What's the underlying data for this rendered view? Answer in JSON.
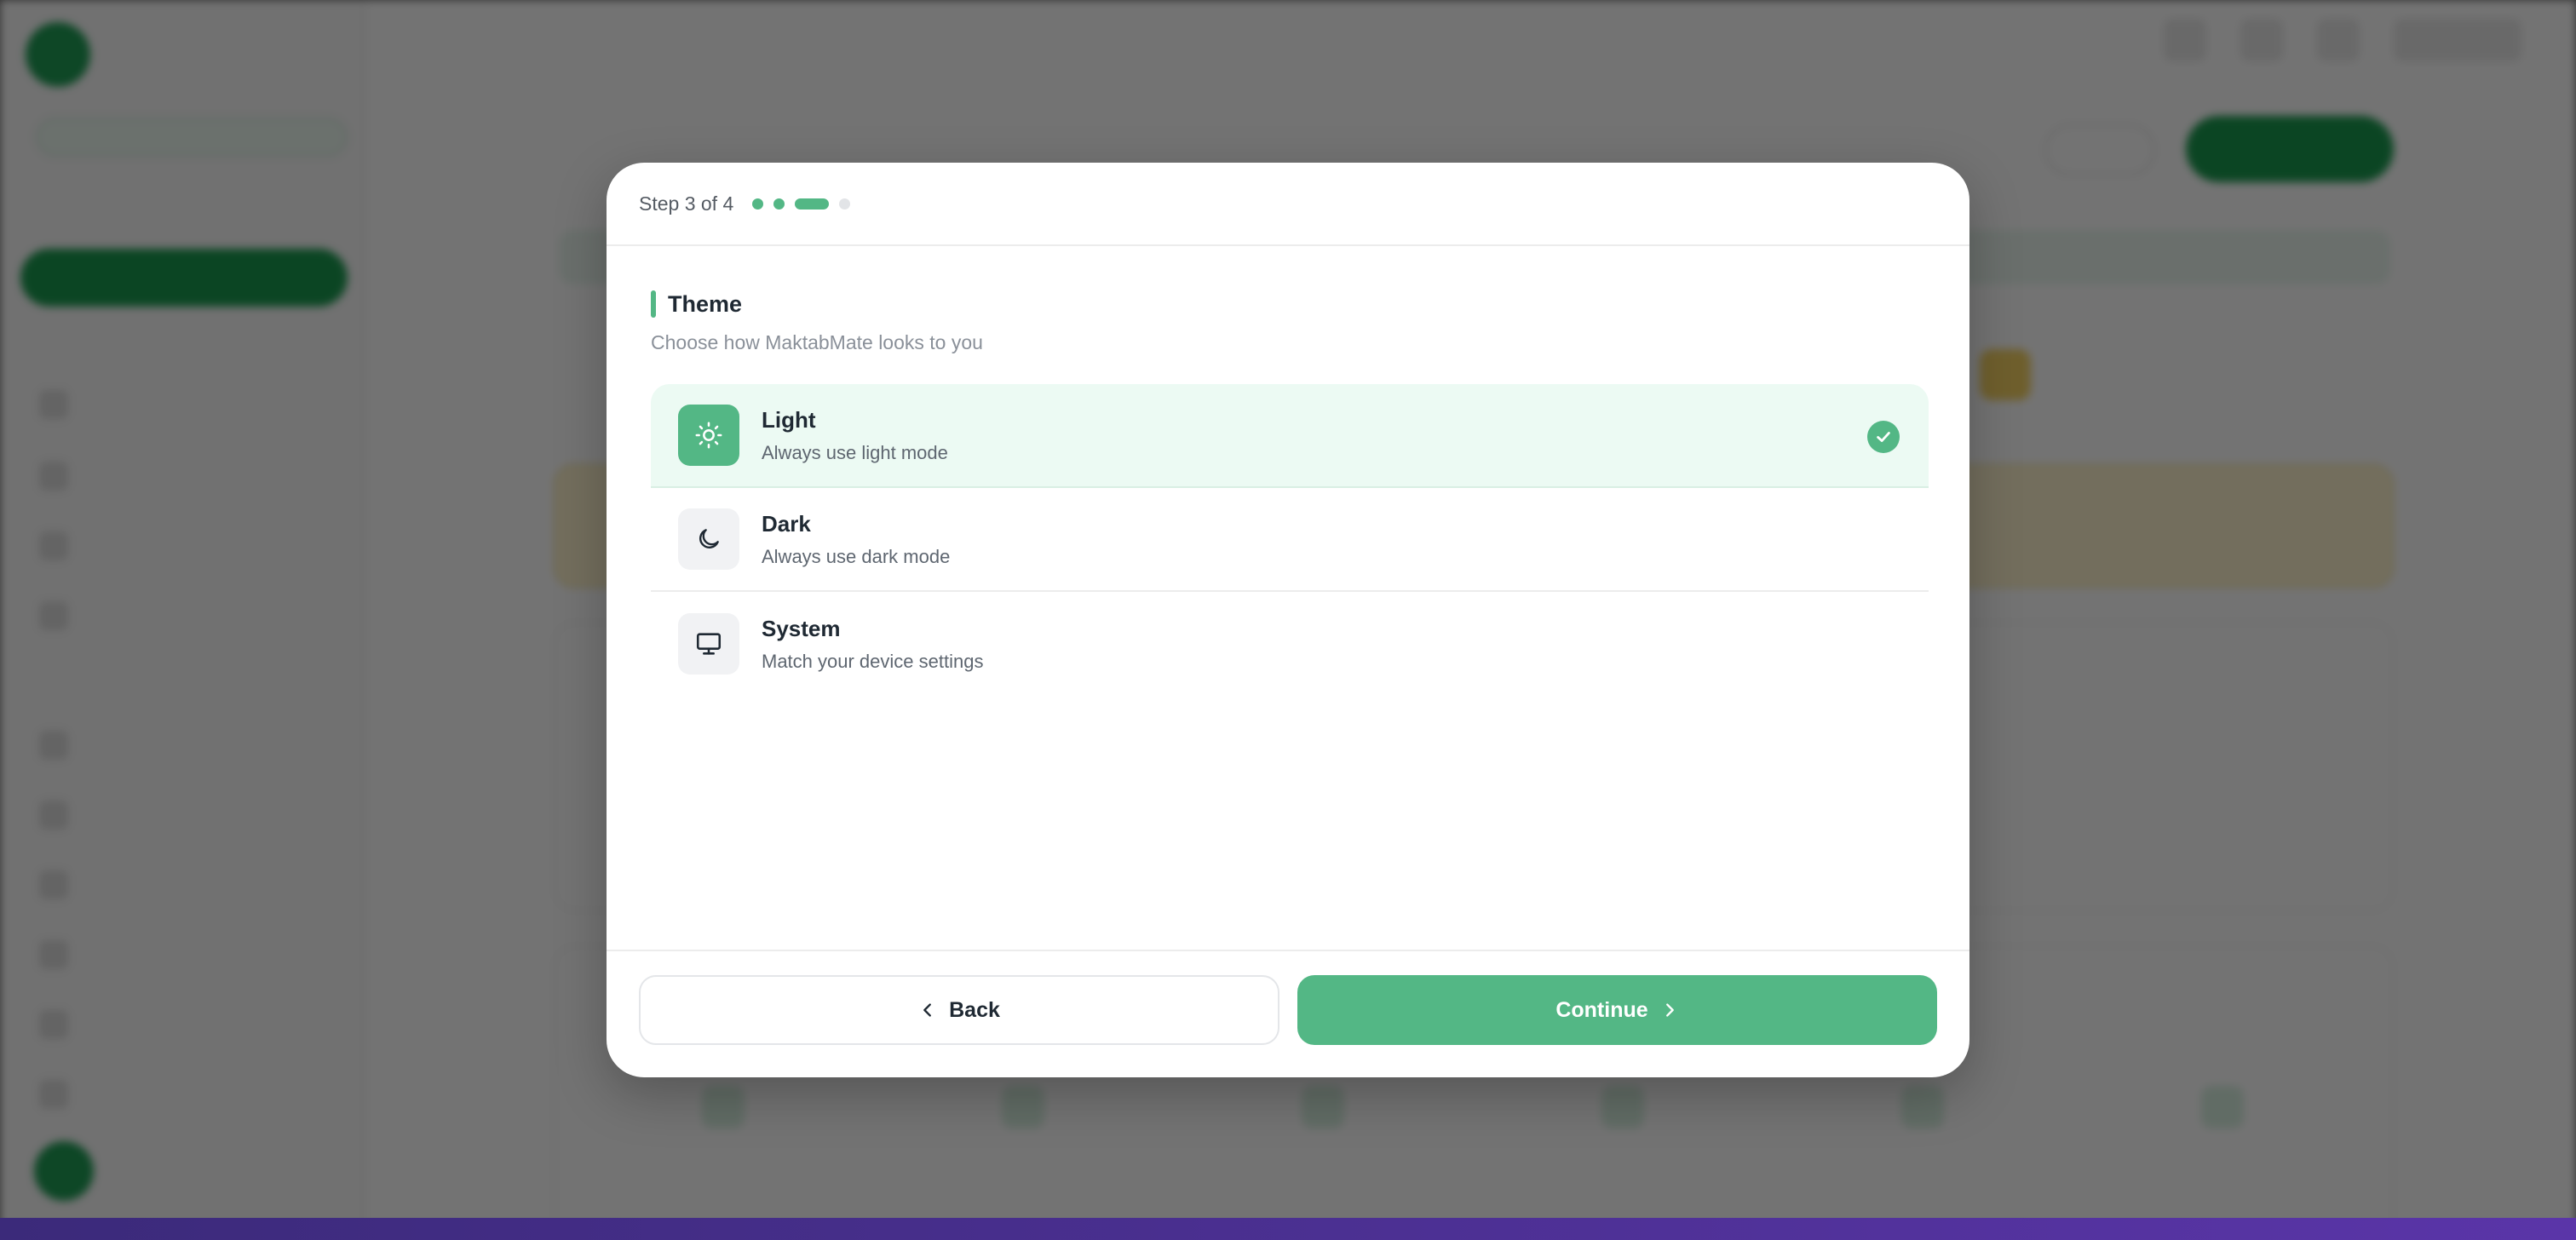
{
  "modal": {
    "step_label": "Step 3 of 4",
    "steps": [
      {
        "state": "done"
      },
      {
        "state": "done"
      },
      {
        "state": "active"
      },
      {
        "state": "pending"
      }
    ],
    "section_title": "Theme",
    "section_subtitle": "Choose how MaktabMate looks to you",
    "options": [
      {
        "title": "Light",
        "description": "Always use light mode",
        "icon": "sun-icon",
        "selected": true
      },
      {
        "title": "Dark",
        "description": "Always use dark mode",
        "icon": "moon-icon",
        "selected": false
      },
      {
        "title": "System",
        "description": "Match your device settings",
        "icon": "monitor-icon",
        "selected": false
      }
    ],
    "back_label": "Back",
    "continue_label": "Continue"
  },
  "colors": {
    "accent": "#53b785",
    "selected_bg": "#ecfaf3",
    "step_pending": "#e2e4e7"
  }
}
